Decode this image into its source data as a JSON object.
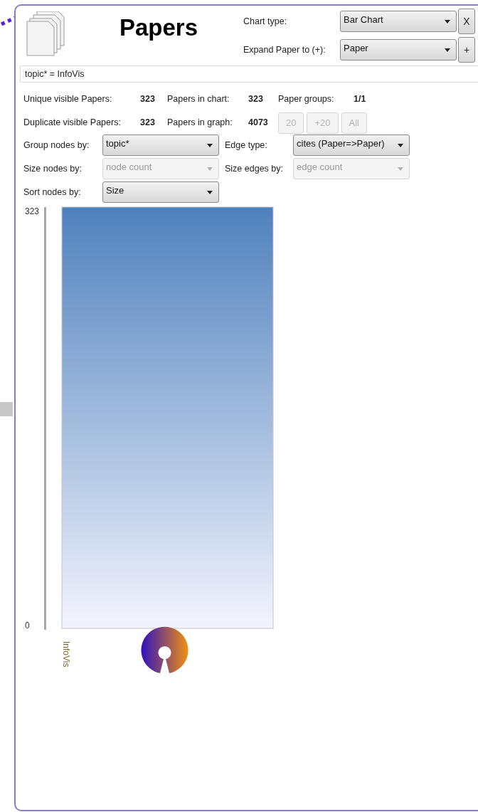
{
  "header": {
    "title": "Papers"
  },
  "chart_type": {
    "label": "Chart type:",
    "value": "Bar Chart",
    "button": "X"
  },
  "expand": {
    "label": "Expand Paper to (+):",
    "value": "Paper",
    "button": "+"
  },
  "filter": {
    "value": "topic* = InfoVis"
  },
  "stats": [
    [
      {
        "label": "Unique visible Papers:",
        "value": "323"
      },
      {
        "label": "Papers in chart:",
        "value": "323"
      },
      {
        "label": "Paper groups:",
        "value": "1/1"
      }
    ],
    [
      {
        "label": "Duplicate visible Papers:",
        "value": "323"
      },
      {
        "label": "Papers in graph:",
        "value": "4073"
      }
    ]
  ],
  "page_buttons": [
    {
      "label": "20",
      "disabled": true
    },
    {
      "label": "+20",
      "disabled": true
    },
    {
      "label": "All",
      "disabled": true
    }
  ],
  "settings": [
    [
      {
        "label": "Group nodes by:",
        "value": "topic*",
        "disabled": false
      },
      {
        "label": "Edge type:",
        "value": "cites (Paper=>Paper)",
        "disabled": false
      }
    ],
    [
      {
        "label": "Size nodes by:",
        "value": "node count",
        "disabled": true
      },
      {
        "label": "Size edges by:",
        "value": "edge count",
        "disabled": true
      }
    ],
    [
      {
        "label": "Sort nodes by:",
        "value": "Size",
        "disabled": false
      }
    ]
  ],
  "chart_data": {
    "type": "bar",
    "categories": [
      "InfoVis"
    ],
    "values": [
      323
    ],
    "ylim": [
      0,
      323
    ],
    "yticks": [
      0,
      323
    ]
  }
}
